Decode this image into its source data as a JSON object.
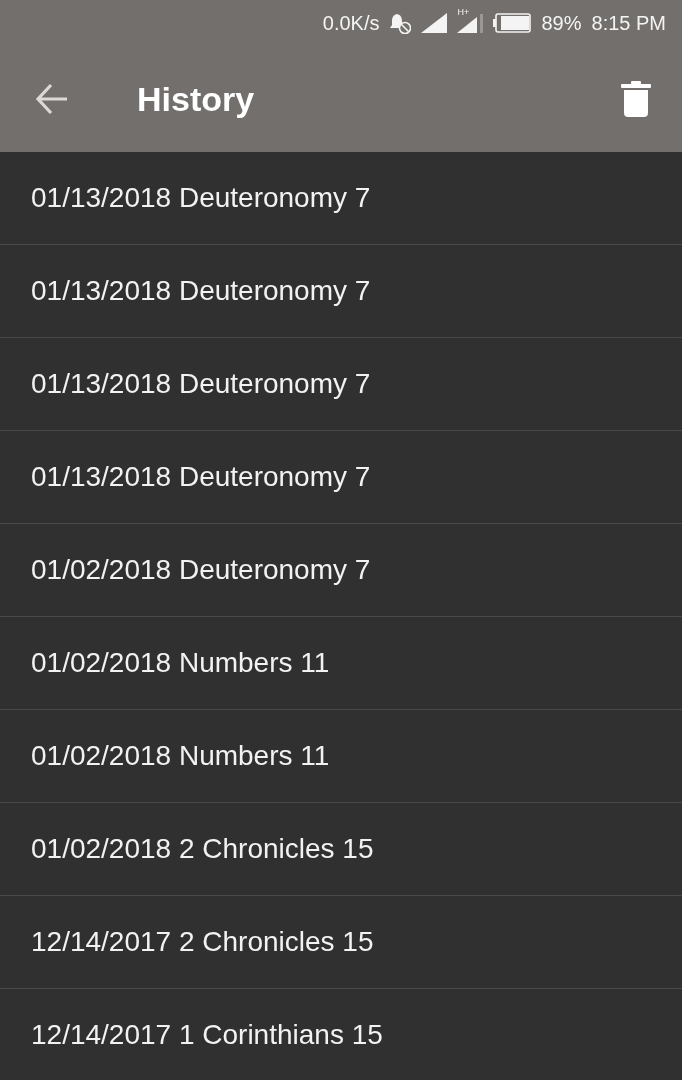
{
  "status_bar": {
    "speed": "0.0K/s",
    "network_label": "H+",
    "battery": "89%",
    "time": "8:15 PM"
  },
  "app_bar": {
    "title": "History"
  },
  "history": [
    {
      "text": "01/13/2018 Deuteronomy 7"
    },
    {
      "text": "01/13/2018 Deuteronomy 7"
    },
    {
      "text": "01/13/2018 Deuteronomy 7"
    },
    {
      "text": "01/13/2018 Deuteronomy 7"
    },
    {
      "text": "01/02/2018 Deuteronomy 7"
    },
    {
      "text": "01/02/2018 Numbers 11"
    },
    {
      "text": "01/02/2018 Numbers 11"
    },
    {
      "text": "01/02/2018 2 Chronicles 15"
    },
    {
      "text": "12/14/2017 2 Chronicles 15"
    },
    {
      "text": "12/14/2017 1 Corinthians 15"
    }
  ]
}
